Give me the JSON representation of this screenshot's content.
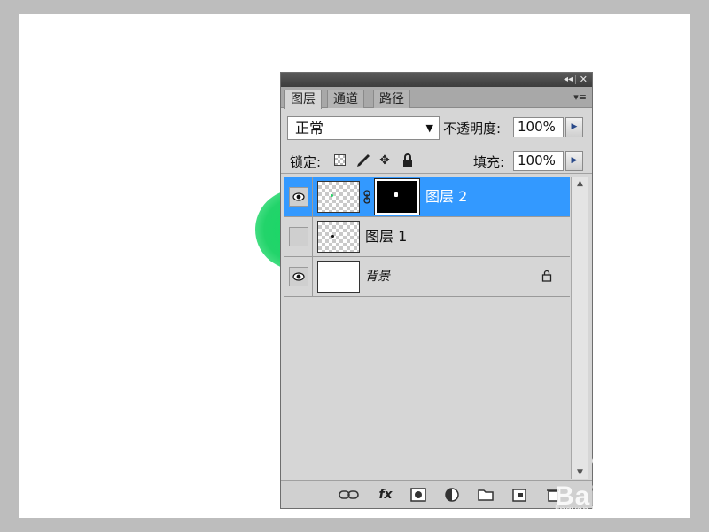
{
  "panel": {
    "collapse_glyph": "◂◂",
    "close_glyph": "✕",
    "menu_glyph": "▾≡",
    "tabs": [
      {
        "label": "图层",
        "active": true
      },
      {
        "label": "通道",
        "active": false
      },
      {
        "label": "路径",
        "active": false
      }
    ],
    "blend_mode": "正常",
    "opacity_label": "不透明度:",
    "opacity_value": "100%",
    "lock_label": "锁定:",
    "fill_label": "填充:",
    "fill_value": "100%"
  },
  "layers": [
    {
      "name": "图层 2",
      "visible": true,
      "selected": true,
      "has_mask": true
    },
    {
      "name": "图层 1",
      "visible": false,
      "selected": false,
      "has_mask": false
    },
    {
      "name": "背景",
      "visible": true,
      "selected": false,
      "locked": true
    }
  ],
  "bottom_icons": [
    "link-layers-icon",
    "fx-icon",
    "add-mask-icon",
    "adjustment-layer-icon",
    "new-group-icon",
    "new-layer-icon",
    "delete-layer-icon"
  ],
  "bottom_labels": {
    "fx": "fx"
  },
  "watermark": {
    "brand": "Baidu经验",
    "url": "jingyan.baidu.com"
  },
  "colors": {
    "selection": "#3399ff",
    "green_object": "#22d46a"
  }
}
